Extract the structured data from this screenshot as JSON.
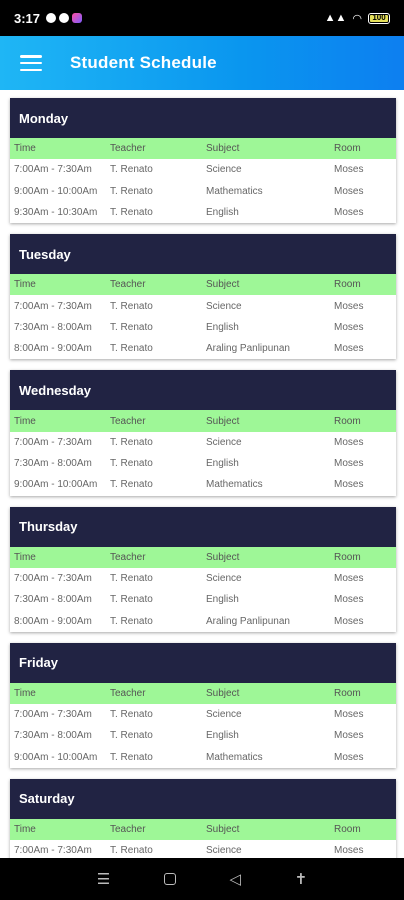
{
  "status_bar": {
    "time": "3:17",
    "battery": "100"
  },
  "appbar": {
    "title": "Student Schedule"
  },
  "columns": [
    "Time",
    "Teacher",
    "Subject",
    "Room"
  ],
  "days": [
    {
      "name": "Monday",
      "rows": [
        [
          "7:00Am - 7:30Am",
          "T. Renato",
          "Science",
          "Moses"
        ],
        [
          "9:00Am - 10:00Am",
          "T. Renato",
          "Mathematics",
          "Moses"
        ],
        [
          "9:30Am - 10:30Am",
          "T. Renato",
          "English",
          "Moses"
        ]
      ]
    },
    {
      "name": "Tuesday",
      "rows": [
        [
          "7:00Am - 7:30Am",
          "T. Renato",
          "Science",
          "Moses"
        ],
        [
          "7:30Am - 8:00Am",
          "T. Renato",
          "English",
          "Moses"
        ],
        [
          "8:00Am - 9:00Am",
          "T. Renato",
          "Araling Panlipunan",
          "Moses"
        ]
      ]
    },
    {
      "name": "Wednesday",
      "rows": [
        [
          "7:00Am - 7:30Am",
          "T. Renato",
          "Science",
          "Moses"
        ],
        [
          "7:30Am - 8:00Am",
          "T. Renato",
          "English",
          "Moses"
        ],
        [
          "9:00Am - 10:00Am",
          "T. Renato",
          "Mathematics",
          "Moses"
        ]
      ]
    },
    {
      "name": "Thursday",
      "rows": [
        [
          "7:00Am - 7:30Am",
          "T. Renato",
          "Science",
          "Moses"
        ],
        [
          "7:30Am - 8:00Am",
          "T. Renato",
          "English",
          "Moses"
        ],
        [
          "8:00Am - 9:00Am",
          "T. Renato",
          "Araling Panlipunan",
          "Moses"
        ]
      ]
    },
    {
      "name": "Friday",
      "rows": [
        [
          "7:00Am - 7:30Am",
          "T. Renato",
          "Science",
          "Moses"
        ],
        [
          "7:30Am - 8:00Am",
          "T. Renato",
          "English",
          "Moses"
        ],
        [
          "9:00Am - 10:00Am",
          "T. Renato",
          "Mathematics",
          "Moses"
        ]
      ]
    },
    {
      "name": "Saturday",
      "rows": [
        [
          "7:00Am - 7:30Am",
          "T. Renato",
          "Science",
          "Moses"
        ]
      ]
    }
  ],
  "colors": {
    "appbar_start": "#1fb6f5",
    "appbar_end": "#0d7ff0",
    "day_header": "#212343",
    "column_header": "#9ef797"
  },
  "nav_icons": [
    "recents-icon",
    "home-icon",
    "back-icon",
    "accessibility-icon"
  ]
}
